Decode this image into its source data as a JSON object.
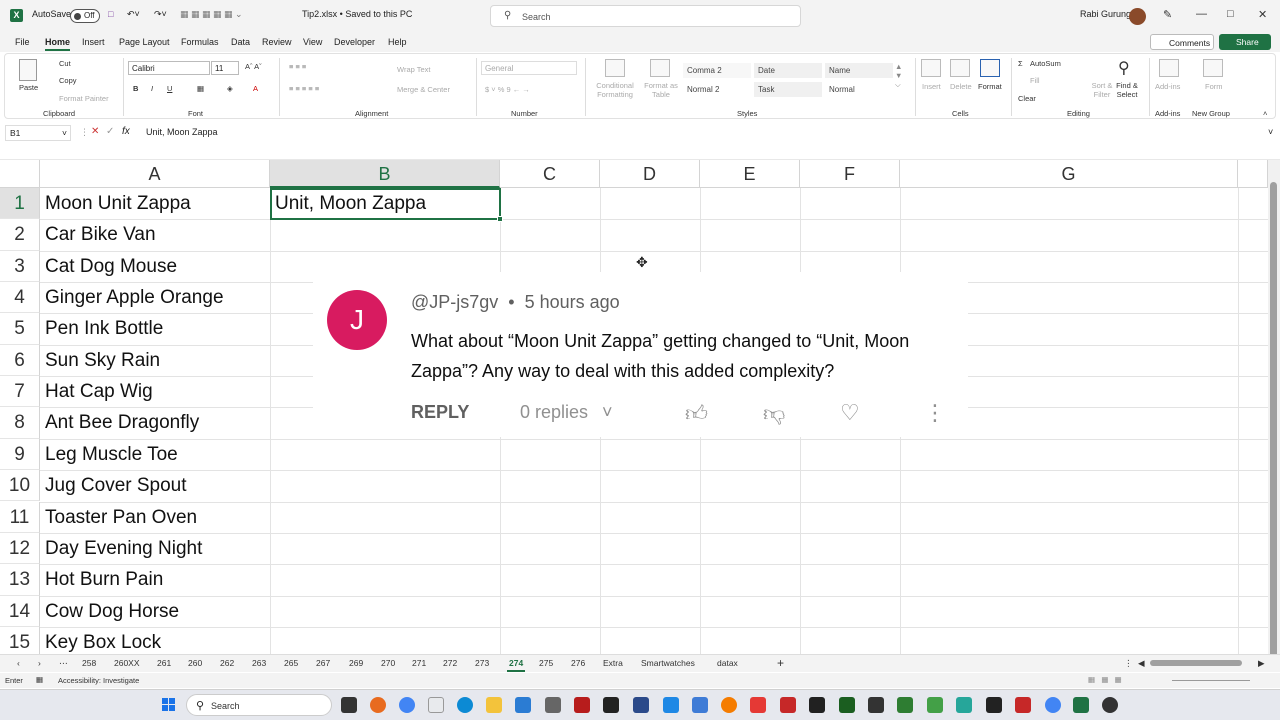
{
  "titlebar": {
    "autosave_label": "AutoSave",
    "autosave_state": "Off",
    "filename": "Tip2.xlsx • Saved to this PC",
    "search_placeholder": "Search",
    "user_name": "Rabi Gurung"
  },
  "ribbon_tabs": [
    "File",
    "Home",
    "Insert",
    "Page Layout",
    "Formulas",
    "Data",
    "Review",
    "View",
    "Developer",
    "Help"
  ],
  "ribbon_buttons": {
    "comments": "Comments",
    "share": "Share"
  },
  "ribbon": {
    "clipboard": {
      "paste": "Paste",
      "cut": "Cut",
      "copy": "Copy",
      "format_painter": "Format Painter",
      "group": "Clipboard"
    },
    "font": {
      "name": "Calibri",
      "size": "11",
      "group": "Font"
    },
    "alignment": {
      "wrap": "Wrap Text",
      "merge": "Merge & Center",
      "group": "Alignment"
    },
    "number": {
      "format": "General",
      "group": "Number"
    },
    "styles": {
      "cond": "Conditional Formatting",
      "table": "Format as Table",
      "s1": "Comma 2",
      "s2": "Date",
      "s3": "Name",
      "s4": "Normal 2",
      "s5": "Task",
      "s6": "Normal",
      "group": "Styles"
    },
    "cells": {
      "insert": "Insert",
      "delete": "Delete",
      "format": "Format",
      "group": "Cells"
    },
    "editing": {
      "autosum": "AutoSum",
      "fill": "Fill",
      "clear": "Clear",
      "sort": "Sort & Filter",
      "find": "Find & Select",
      "group": "Editing"
    },
    "addins": {
      "label": "Add-ins",
      "group": "Add-ins"
    },
    "newgroup": {
      "label": "Form",
      "group": "New Group"
    }
  },
  "formula_bar": {
    "name_box": "B1",
    "fx": "fx",
    "value": "Unit, Moon Zappa"
  },
  "columns": [
    "A",
    "B",
    "C",
    "D",
    "E",
    "F",
    "G"
  ],
  "rows": [
    "1",
    "2",
    "3",
    "4",
    "5",
    "6",
    "7",
    "8",
    "9",
    "10",
    "11",
    "12",
    "13",
    "14",
    "15"
  ],
  "column_a": [
    "Moon Unit Zappa",
    "Car Bike Van",
    "Cat Dog Mouse",
    "Ginger Apple Orange",
    "Pen Ink Bottle",
    "Sun Sky Rain",
    "Hat Cap Wig",
    "Ant Bee Dragonfly",
    "Leg Muscle Toe",
    "Jug Cover Spout",
    "Toaster Pan Oven",
    "Day Evening Night",
    "Hot Burn Pain",
    "Cow Dog Horse",
    "Key Box Lock"
  ],
  "cell_b1": "Unit, Moon Zappa",
  "comment": {
    "avatar_letter": "J",
    "author": "@JP-js7gv",
    "time": "5 hours ago",
    "text": "What about “Moon Unit Zappa” getting changed to “Unit, Moon Zappa”? Any way to deal with this added complexity?",
    "reply": "REPLY",
    "replies": "0 replies"
  },
  "sheet_tabs": [
    "258",
    "260XX",
    "261",
    "260",
    "262",
    "263",
    "265",
    "267",
    "269",
    "270",
    "271",
    "272",
    "273",
    "274",
    "275",
    "276",
    "Extra",
    "Smartwatches",
    "datax"
  ],
  "active_sheet": "274",
  "status": {
    "mode": "Enter",
    "accessibility": "Accessibility: Investigate"
  },
  "taskbar": {
    "search": "Search"
  },
  "colors": {
    "excel_green": "#1f7244",
    "avatar_pink": "#d81b60"
  }
}
